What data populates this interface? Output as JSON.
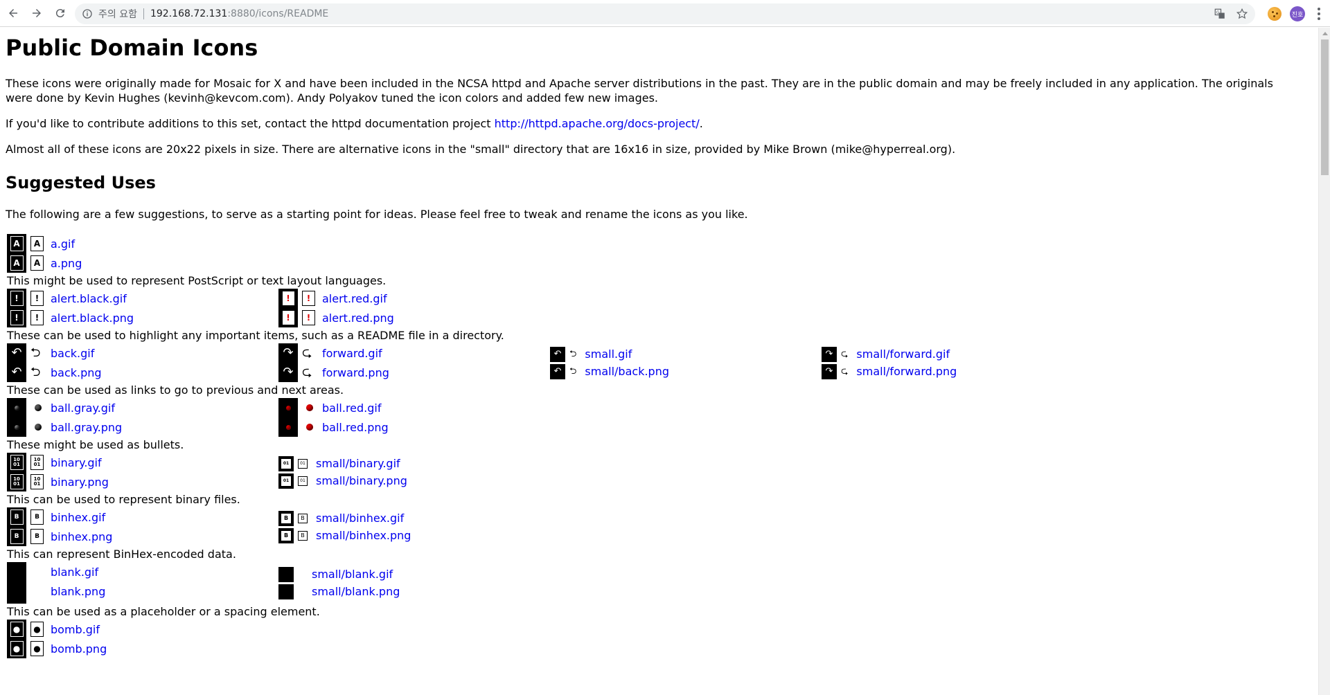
{
  "browser": {
    "security_label": "주의 요함",
    "url_host": "192.168.72.131",
    "url_path": ":8880/icons/README",
    "avatar_text": "진호"
  },
  "page": {
    "title": "Public Domain Icons",
    "intro_1": "These icons were originally made for Mosaic for X and have been included in the NCSA httpd and Apache server distributions in the past. They are in the public domain and may be freely included in any application. The originals were done by Kevin Hughes (kevinh@kevcom.com). Andy Polyakov tuned the icon colors and added few new images.",
    "intro_2_prefix": "If you'd like to contribute additions to this set, contact the httpd documentation project ",
    "intro_2_link": "http://httpd.apache.org/docs-project/",
    "intro_2_suffix": ".",
    "intro_3": "Almost all of these icons are 20x22 pixels in size. There are alternative icons in the \"small\" directory that are 16x16 in size, provided by Mike Brown (mike@hyperreal.org).",
    "section_title": "Suggested Uses",
    "section_intro": "The following are a few suggestions, to serve as a starting point for ideas. Please feel free to tweak and rename the icons as you like."
  },
  "icons": {
    "a": {
      "gif": "a.gif",
      "png": "a.png",
      "desc": "This might be used to represent PostScript or text layout languages."
    },
    "alert": {
      "black_gif": "alert.black.gif",
      "black_png": "alert.black.png",
      "red_gif": "alert.red.gif",
      "red_png": "alert.red.png",
      "desc": "These can be used to highlight any important items, such as a README file in a directory."
    },
    "nav": {
      "back_gif": "back.gif",
      "back_png": "back.png",
      "forward_gif": "forward.gif",
      "forward_png": "forward.png",
      "small_gif": "small.gif",
      "small_back_png": "small/back.png",
      "small_forward_gif": "small/forward.gif",
      "small_forward_png": "small/forward.png",
      "desc": "These can be used as links to go to previous and next areas."
    },
    "ball": {
      "gray_gif": "ball.gray.gif",
      "gray_png": "ball.gray.png",
      "red_gif": "ball.red.gif",
      "red_png": "ball.red.png",
      "desc": "These might be used as bullets."
    },
    "binary": {
      "gif": "binary.gif",
      "png": "binary.png",
      "small_gif": "small/binary.gif",
      "small_png": "small/binary.png",
      "desc": "This can be used to represent binary files."
    },
    "binhex": {
      "gif": "binhex.gif",
      "png": "binhex.png",
      "small_gif": "small/binhex.gif",
      "small_png": "small/binhex.png",
      "desc": "This can represent BinHex-encoded data."
    },
    "blank": {
      "gif": "blank.gif",
      "png": "blank.png",
      "small_gif": "small/blank.gif",
      "small_png": "small/blank.png",
      "desc": "This can be used as a placeholder or a spacing element."
    },
    "bomb": {
      "gif": "bomb.gif",
      "png": "bomb.png"
    }
  },
  "colors": {
    "link": "#0000ee",
    "alert_red": "#dd0000"
  }
}
